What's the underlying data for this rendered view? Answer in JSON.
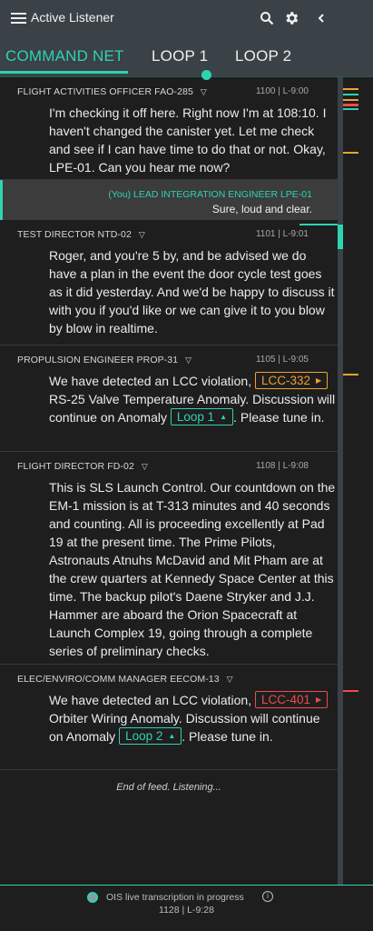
{
  "app": {
    "title": "Active Listener",
    "search_icon": "search-icon",
    "settings_icon": "gear-icon",
    "back_icon": "chevron-left-icon"
  },
  "tabs": [
    {
      "label": "COMMAND NET",
      "active": true
    },
    {
      "label": "LOOP 1",
      "active": false
    },
    {
      "label": "LOOP 2",
      "active": false
    }
  ],
  "feed": {
    "entries": [
      {
        "speaker": "FLIGHT ACTIVITIES OFFICER FAO-285",
        "meta": "1100 | L-9:00",
        "text": "I'm checking it off here. Right now I'm at 108:10. I haven't changed the canister yet. Let me check and see if I can have time to do that or not. Okay, LPE-01. Can you hear me now?"
      },
      {
        "speaker": "(You) LEAD INTEGRATION ENGINEER  LPE-01",
        "text": "Sure, loud and clear."
      },
      {
        "speaker": "TEST DIRECTOR NTD-02",
        "meta": "1101 | L-9:01",
        "text": "Roger, and you're 5 by, and be advised we do have a plan in the event the door cycle test goes as it did yesterday. And we'd be happy to discuss it with you if you'd like or we can give it to you blow by blow in realtime."
      },
      {
        "speaker": "PROPULSION ENGINEER PROP-31",
        "meta": "1105 | L-9:05",
        "text_a": "We have detected an LCC violation,",
        "lcc": "LCC-332",
        "text_b": "RS-25 Valve Temperature Anomaly. Discussion will continue on Anomaly",
        "loop": "Loop 1",
        "text_c": ". Please tune in."
      },
      {
        "speaker": "FLIGHT DIRECTOR FD-02",
        "meta": "1108 | L-9:08",
        "text": "This is SLS Launch Control. Our countdown on the EM-1 mission is at T-313 minutes and 40 seconds and counting. All is proceeding excellently at Pad 19 at the present time. The Prime Pilots, Astronauts Atnuhs McDavid and Mit Pham are at the crew quarters at Kennedy Space Center at this time. The backup pilot's Daene Stryker and J.J. Hammer are aboard the Orion Spacecraft at Launch Complex 19, going through a complete series of preliminary checks."
      },
      {
        "speaker": "ELEC/ENVIRO/COMM MANAGER EECOM-13",
        "text_a": "We have detected an LCC violation,",
        "lcc": "LCC-401",
        "text_b": "Orbiter Wiring Anomaly. Discussion will continue on Anomaly",
        "loop": "Loop 2",
        "text_c": ". Please tune in."
      }
    ],
    "end_text": "End of feed. Listening..."
  },
  "footer": {
    "status": "OIS live transcription in progress",
    "meta": "1128 | L-9:28"
  },
  "colors": {
    "accent": "#2ed3b0",
    "warning": "#f0a030",
    "alert": "#ef4a4a",
    "bar": "#3a4147",
    "background": "#1e1e1e"
  }
}
